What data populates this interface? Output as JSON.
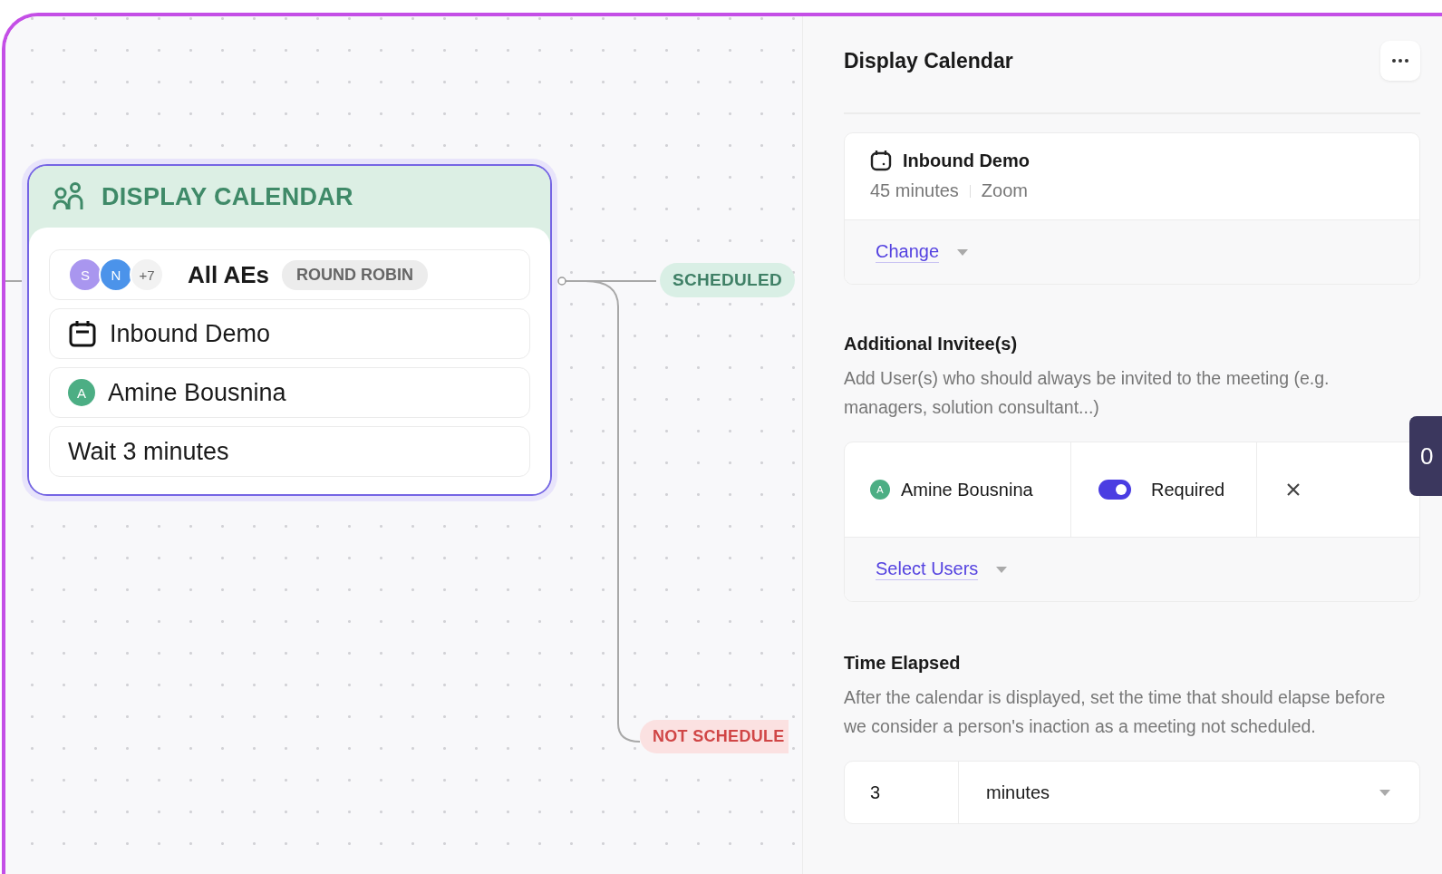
{
  "node": {
    "title": "DISPLAY CALENDAR",
    "assignees": {
      "avatars": [
        {
          "initial": "S",
          "color": "#a996ef"
        },
        {
          "initial": "N",
          "color": "#4b93ea"
        }
      ],
      "more": "+7",
      "name": "All AEs",
      "badge": "ROUND ROBIN"
    },
    "meeting": "Inbound Demo",
    "host": {
      "initial": "A",
      "name": "Amine Bousnina"
    },
    "wait": "Wait 3 minutes"
  },
  "branches": [
    {
      "label": "SCHEDULED",
      "kind": "success"
    },
    {
      "label": "NOT SCHEDULE",
      "kind": "failure"
    }
  ],
  "panel": {
    "title": "Display Calendar",
    "meeting_card": {
      "name": "Inbound Demo",
      "duration": "45 minutes",
      "location": "Zoom",
      "change_link": "Change"
    },
    "invitees": {
      "heading": "Additional Invitee(s)",
      "description": "Add User(s) who should always be invited to the meeting (e.g. managers, solution consultant...)",
      "rows": [
        {
          "initial": "A",
          "name": "Amine Bousnina",
          "required": true,
          "required_label": "Required"
        }
      ],
      "select_link": "Select Users"
    },
    "time_elapsed": {
      "heading": "Time Elapsed",
      "description": "After the calendar is displayed, set the time that should elapse before we consider a person's inaction as a meeting not scheduled.",
      "amount": "3",
      "unit": "minutes"
    }
  },
  "side_tab": {
    "label": "0"
  }
}
